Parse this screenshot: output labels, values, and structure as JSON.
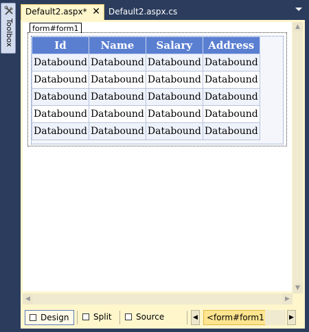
{
  "toolbox": {
    "label": "Toolbox",
    "icon": "toolbox-icon"
  },
  "tabs": [
    {
      "label": "Default2.aspx*",
      "active": true,
      "close": "✕"
    },
    {
      "label": "Default2.aspx.cs",
      "active": false
    }
  ],
  "form": {
    "tag": "form#form1"
  },
  "grid": {
    "headers": [
      "Id",
      "Name",
      "Salary",
      "Address"
    ],
    "rows": [
      [
        "Databound",
        "Databound",
        "Databound",
        "Databound"
      ],
      [
        "Databound",
        "Databound",
        "Databound",
        "Databound"
      ],
      [
        "Databound",
        "Databound",
        "Databound",
        "Databound"
      ],
      [
        "Databound",
        "Databound",
        "Databound",
        "Databound"
      ],
      [
        "Databound",
        "Databound",
        "Databound",
        "Databound"
      ]
    ]
  },
  "bottom": {
    "design": "Design",
    "split": "Split",
    "source": "Source",
    "breadcrumb": "<form#form1>"
  },
  "colors": {
    "header_bg": "#5a7fd1",
    "frame_bg": "#fff6cc",
    "window_bg": "#2b3c5d"
  }
}
